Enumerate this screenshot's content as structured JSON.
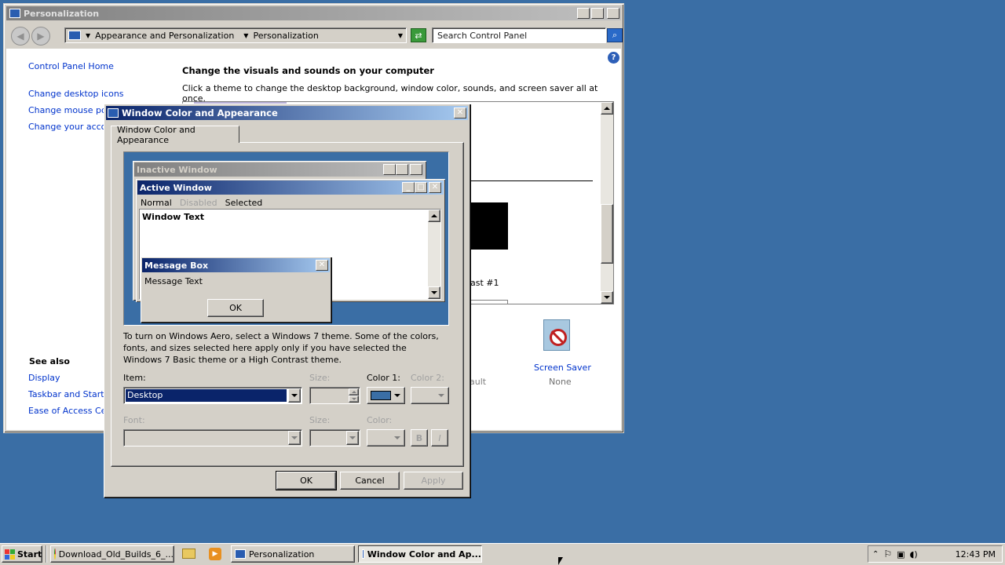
{
  "personalization_window": {
    "title": "Personalization",
    "breadcrumb": [
      "Appearance and Personalization",
      "Personalization"
    ],
    "search_placeholder": "Search Control Panel",
    "sidebar_links": [
      "Control Panel Home",
      "Change desktop icons",
      "Change mouse point",
      "Change your accou"
    ],
    "see_also_heading": "See also",
    "see_also_links": [
      "Display",
      "Taskbar and Start M",
      "Ease of Access Cent"
    ],
    "heading": "Change the visuals and sounds on your computer",
    "subtext": "Click a theme to change the desktop background, window color, sounds, and screen saver all at once.",
    "theme_label_fragment": "ast #1",
    "default_fragment": "ault",
    "screen_saver_label": "Screen Saver",
    "screen_saver_value": "None"
  },
  "dialog": {
    "title": "Window Color and Appearance",
    "tab": "Window Color and Appearance",
    "preview": {
      "inactive_title": "Inactive Window",
      "active_title": "Active Window",
      "menu": [
        "Normal",
        "Disabled",
        "Selected"
      ],
      "window_text": "Window Text",
      "msgbox_title": "Message Box",
      "msgbox_text": "Message Text",
      "msgbox_ok": "OK"
    },
    "info_text": "To turn on Windows Aero, select a Windows 7 theme.  Some of the colors, fonts, and sizes selected here apply only if you have selected the Windows 7 Basic theme or a High Contrast theme.",
    "item_label": "Item:",
    "item_value": "Desktop",
    "size_label": "Size:",
    "color1_label": "Color 1:",
    "color1_value": "#3a6ea5",
    "color2_label": "Color 2:",
    "font_label": "Font:",
    "size2_label": "Size:",
    "color_label": "Color:",
    "bold_label": "B",
    "italic_label": "I",
    "ok": "OK",
    "cancel": "Cancel",
    "apply": "Apply"
  },
  "taskbar": {
    "start": "Start",
    "items": [
      "Download_Old_Builds_6_...",
      "Personalization",
      "Window Color and Ap..."
    ],
    "clock": "12:43 PM"
  }
}
